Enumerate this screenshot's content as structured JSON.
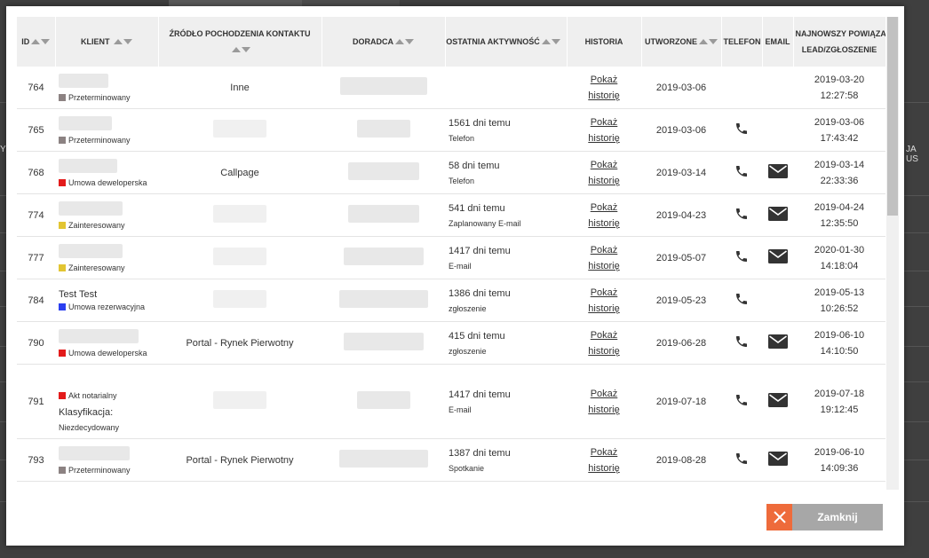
{
  "headers": {
    "id": "ID",
    "client": "KLIENT",
    "source": "ŹRÓDŁO POCHODZENIA KONTAKTU",
    "advisor": "DORADCA",
    "last_activity": "OSTATNIA AKTYWNOŚĆ",
    "history": "HISTORIA",
    "created": "UTWORZONE",
    "phone": "TELEFON",
    "email": "EMAIL",
    "latest_line1": "NAJNOWSZY POWIĄZANY",
    "latest_line2": "LEAD/ZGŁOSZENIE"
  },
  "history_link": {
    "line1": "Pokaż",
    "line2": "historię"
  },
  "rows": [
    {
      "id": "764",
      "status": "Przeterminowany",
      "status_color": "#8c8282",
      "source": "Inne",
      "activity": "",
      "activity_type": "",
      "created": "2019-03-06",
      "latest_date": "2019-03-20",
      "latest_time": "12:27:58",
      "phone": false,
      "email": false
    },
    {
      "id": "765",
      "status": "Przeterminowany",
      "status_color": "#8c8282",
      "source": "",
      "activity": "1561 dni temu",
      "activity_type": "Telefon",
      "created": "2019-03-06",
      "latest_date": "2019-03-06",
      "latest_time": "17:43:42",
      "phone": true,
      "email": false
    },
    {
      "id": "768",
      "status": "Umowa deweloperska",
      "status_color": "#e31b1b",
      "source": "Callpage",
      "activity": "58 dni temu",
      "activity_type": "Telefon",
      "created": "2019-03-14",
      "latest_date": "2019-03-14",
      "latest_time": "22:33:36",
      "phone": true,
      "email": true
    },
    {
      "id": "774",
      "status": "Zainteresowany",
      "status_color": "#e2c532",
      "source": "",
      "activity": "541 dni temu",
      "activity_type": "Zaplanowany E-mail",
      "created": "2019-04-23",
      "latest_date": "2019-04-24",
      "latest_time": "12:35:50",
      "phone": true,
      "email": true
    },
    {
      "id": "777",
      "status": "Zainteresowany",
      "status_color": "#e2c532",
      "source": "",
      "activity": "1417 dni temu",
      "activity_type": "E-mail",
      "created": "2019-05-07",
      "latest_date": "2020-01-30",
      "latest_time": "14:18:04",
      "phone": true,
      "email": true
    },
    {
      "id": "784",
      "client": "Test Test",
      "status": "Umowa rezerwacyjna",
      "status_color": "#2b3ff0",
      "source": "",
      "activity": "1386 dni temu",
      "activity_type": "zgłoszenie",
      "created": "2019-05-23",
      "latest_date": "2019-05-13",
      "latest_time": "10:26:52",
      "phone": true,
      "email": false
    },
    {
      "id": "790",
      "status": "Umowa deweloperska",
      "status_color": "#e31b1b",
      "source": "Portal - Rynek Pierwotny",
      "activity": "415 dni temu",
      "activity_type": "zgłoszenie",
      "created": "2019-06-28",
      "latest_date": "2019-06-10",
      "latest_time": "14:10:50",
      "phone": true,
      "email": true
    },
    {
      "id": "791",
      "status": "Akt notarialny",
      "status_color": "#e31b1b",
      "extra_label": "Klasyfikacja:",
      "extra_value": "Niezdecydowany",
      "source": "",
      "activity": "1417 dni temu",
      "activity_type": "E-mail",
      "created": "2019-07-18",
      "latest_date": "2019-07-18",
      "latest_time": "19:12:45",
      "phone": true,
      "email": true
    },
    {
      "id": "793",
      "status": "Przeterminowany",
      "status_color": "#8c8282",
      "source": "Portal - Rynek Pierwotny",
      "activity": "1387 dni temu",
      "activity_type": "Spotkanie",
      "created": "2019-08-28",
      "latest_date": "2019-06-10",
      "latest_time": "14:09:36",
      "phone": true,
      "email": true
    }
  ],
  "close_button": {
    "label": "Zamknij"
  },
  "background": {
    "header_fragment_left": "YO",
    "header_fragment_right": "JA US"
  },
  "icons": {
    "phone": "phone-icon",
    "email": "envelope-icon",
    "sort": "sort-arrows-icon",
    "close": "close-x-icon"
  },
  "colors": {
    "accent_orange": "#ee6b3b",
    "button_gray": "#a7a7a7",
    "icon_dark": "#333333"
  }
}
